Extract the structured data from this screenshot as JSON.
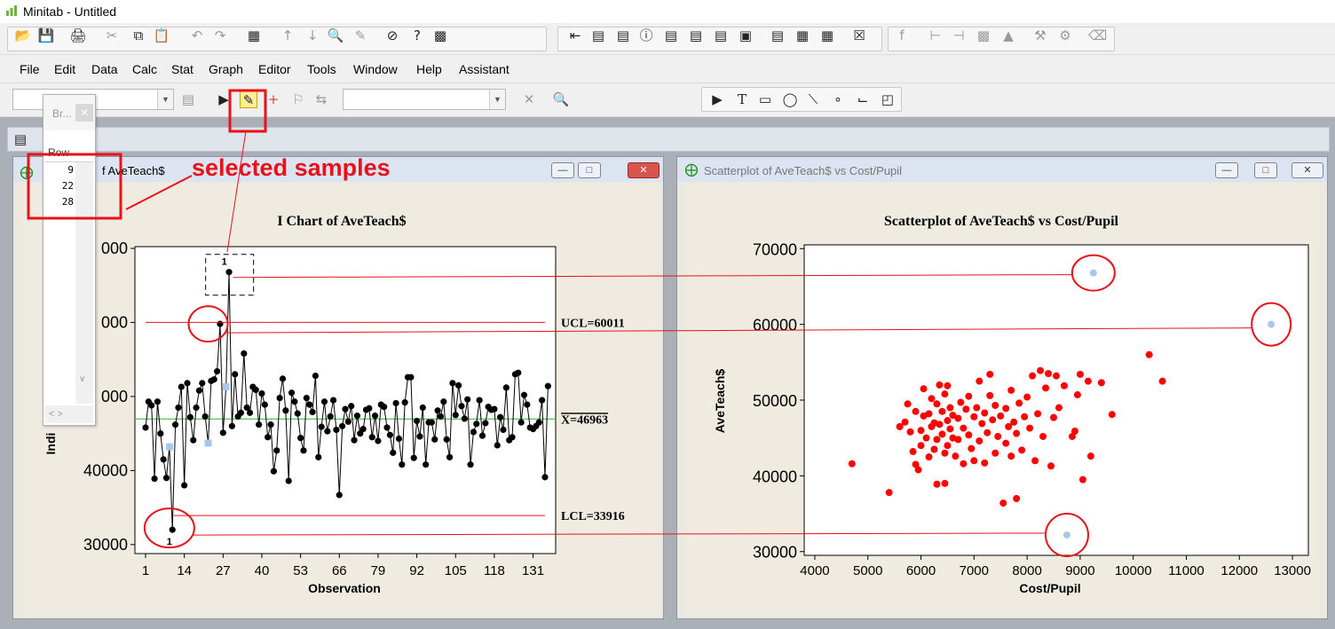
{
  "app": {
    "title": "Minitab - Untitled"
  },
  "menus": [
    "File",
    "Edit",
    "Data",
    "Calc",
    "Stat",
    "Graph",
    "Editor",
    "Tools",
    "Window",
    "Help",
    "Assistant"
  ],
  "menu_underline": [
    "F",
    "E",
    "D",
    "C",
    "S",
    "G",
    "E",
    "T",
    "W",
    "H",
    "A"
  ],
  "toolbar": {
    "icons": [
      "open-icon",
      "save-icon",
      "print-icon",
      "cut-icon",
      "copy-icon",
      "paste-icon",
      "undo-icon",
      "redo-icon",
      "worksheet-icon",
      "up-arrow-icon",
      "down-arrow-icon",
      "find-icon",
      "replace-icon",
      "cancel-icon",
      "help-icon",
      "assistant-icon"
    ]
  },
  "brush_palette": {
    "title": "Br...",
    "column_header": "Row",
    "rows": [
      "9",
      "22",
      "28"
    ]
  },
  "annotation": {
    "label": "selected samples",
    "color": "#e8121a"
  },
  "left_window": {
    "caption": "I Chart of AveTeach$",
    "caption_visible": "f AveTeach$"
  },
  "right_window": {
    "caption": "Scatterplot of AveTeach$ vs Cost/Pupil"
  },
  "chart_data": [
    {
      "type": "line",
      "title": "I Chart of AveTeach$",
      "xlabel": "Observation",
      "ylabel": "Indi",
      "xlim": [
        1,
        135
      ],
      "ylim": [
        29500,
        70000
      ],
      "x_ticks": [
        1,
        14,
        27,
        40,
        53,
        66,
        79,
        92,
        105,
        118,
        131
      ],
      "y_ticks_labels": [
        "000",
        "000",
        "000",
        "40000",
        "30000"
      ],
      "y_ticks_values": [
        70000,
        60000,
        50000,
        40000,
        30000
      ],
      "control_lines": [
        {
          "label": "UCL=60011",
          "value": 60011
        },
        {
          "label": "X=46963",
          "value": 46963
        },
        {
          "label": "LCL=33916",
          "value": 33916
        }
      ],
      "out_of_control_label": "1",
      "highlighted_points": [
        {
          "x": 9,
          "y": 32000
        },
        {
          "x": 22,
          "y": 59800
        },
        {
          "x": 28,
          "y": 66800
        }
      ],
      "values": [
        45800,
        49300,
        48800,
        38900,
        49300,
        45000,
        41500,
        39000,
        43200,
        32000,
        46200,
        48500,
        51300,
        38000,
        51800,
        47200,
        44100,
        48500,
        50800,
        51800,
        47300,
        43700,
        52100,
        52300,
        53400,
        59800,
        45100,
        51300,
        66800,
        46000,
        53000,
        47300,
        47800,
        55800,
        48500,
        47800,
        51300,
        50900,
        46200,
        50400,
        48900,
        44500,
        46200,
        39900,
        42700,
        49800,
        52400,
        48100,
        38600,
        50500,
        49300,
        47700,
        44400,
        42700,
        49800,
        48900,
        47900,
        52800,
        41800,
        45900,
        49300,
        45300,
        47300,
        49500,
        45500,
        36700,
        46000,
        48300,
        46600,
        48700,
        44100,
        47400,
        45000,
        45600,
        48200,
        48400,
        44500,
        47400,
        44000,
        48900,
        48600,
        45800,
        44800,
        42400,
        49100,
        44300,
        40800,
        49200,
        52600,
        52600,
        41700,
        46700,
        44600,
        48500,
        40800,
        46500,
        46500,
        44200,
        48100,
        47300,
        49300,
        44200,
        41800,
        51800,
        47500,
        51500,
        48700,
        47000,
        49600,
        40800,
        45200,
        46300,
        49500,
        44700,
        46400,
        48600,
        48200,
        48300,
        43400,
        47200,
        45500,
        51200,
        44100,
        44500,
        53000,
        53200,
        46500,
        50200,
        48900,
        45800,
        45600,
        46000,
        46500,
        49500,
        39100,
        51400
      ]
    },
    {
      "type": "scatter",
      "title": "Scatterplot of AveTeach$ vs Cost/Pupil",
      "xlabel": "Cost/Pupil",
      "ylabel": "AveTeach$",
      "xlim": [
        3800,
        13300
      ],
      "ylim": [
        29500,
        70500
      ],
      "x_ticks": [
        4000,
        5000,
        6000,
        7000,
        8000,
        9000,
        10000,
        11000,
        12000,
        13000
      ],
      "y_ticks": [
        30000,
        40000,
        50000,
        60000,
        70000
      ],
      "highlighted_points": [
        {
          "x": 9250,
          "y": 66800
        },
        {
          "x": 12600,
          "y": 60000
        },
        {
          "x": 8750,
          "y": 32200
        }
      ],
      "points": [
        [
          4700,
          41600
        ],
        [
          5400,
          37800
        ],
        [
          5600,
          46500
        ],
        [
          5700,
          47100
        ],
        [
          5750,
          49500
        ],
        [
          5800,
          45800
        ],
        [
          5850,
          43200
        ],
        [
          5900,
          48500
        ],
        [
          5900,
          41500
        ],
        [
          5950,
          40800
        ],
        [
          6000,
          46000
        ],
        [
          6000,
          44000
        ],
        [
          6050,
          47900
        ],
        [
          6050,
          51500
        ],
        [
          6100,
          45000
        ],
        [
          6150,
          42500
        ],
        [
          6150,
          48200
        ],
        [
          6200,
          46500
        ],
        [
          6200,
          50200
        ],
        [
          6250,
          43500
        ],
        [
          6250,
          47000
        ],
        [
          6300,
          49500
        ],
        [
          6300,
          44800
        ],
        [
          6300,
          38900
        ],
        [
          6350,
          46800
        ],
        [
          6350,
          52000
        ],
        [
          6400,
          45500
        ],
        [
          6400,
          48500
        ],
        [
          6450,
          43000
        ],
        [
          6450,
          50800
        ],
        [
          6450,
          39000
        ],
        [
          6500,
          47300
        ],
        [
          6500,
          44000
        ],
        [
          6500,
          51900
        ],
        [
          6550,
          46200
        ],
        [
          6550,
          49000
        ],
        [
          6600,
          45000
        ],
        [
          6600,
          48000
        ],
        [
          6650,
          42600
        ],
        [
          6700,
          47600
        ],
        [
          6700,
          44800
        ],
        [
          6750,
          49700
        ],
        [
          6800,
          46300
        ],
        [
          6800,
          41600
        ],
        [
          6850,
          48800
        ],
        [
          6900,
          45400
        ],
        [
          6900,
          50500
        ],
        [
          6950,
          43600
        ],
        [
          7000,
          47800
        ],
        [
          7000,
          42000
        ],
        [
          7050,
          49000
        ],
        [
          7100,
          44600
        ],
        [
          7100,
          52500
        ],
        [
          7150,
          46900
        ],
        [
          7200,
          48300
        ],
        [
          7200,
          41700
        ],
        [
          7250,
          45700
        ],
        [
          7300,
          50600
        ],
        [
          7300,
          53400
        ],
        [
          7350,
          47400
        ],
        [
          7400,
          43000
        ],
        [
          7400,
          49300
        ],
        [
          7450,
          45200
        ],
        [
          7500,
          47900
        ],
        [
          7550,
          36400
        ],
        [
          7600,
          44300
        ],
        [
          7600,
          48900
        ],
        [
          7650,
          46500
        ],
        [
          7700,
          42600
        ],
        [
          7700,
          51300
        ],
        [
          7750,
          47100
        ],
        [
          7800,
          37000
        ],
        [
          7800,
          45600
        ],
        [
          7850,
          49600
        ],
        [
          7900,
          43400
        ],
        [
          7950,
          47800
        ],
        [
          8000,
          50400
        ],
        [
          8050,
          46300
        ],
        [
          8100,
          53200
        ],
        [
          8150,
          42000
        ],
        [
          8200,
          48200
        ],
        [
          8250,
          53900
        ],
        [
          8300,
          45200
        ],
        [
          8350,
          51600
        ],
        [
          8400,
          53500
        ],
        [
          8450,
          41300
        ],
        [
          8500,
          47700
        ],
        [
          8550,
          53200
        ],
        [
          8600,
          49000
        ],
        [
          8700,
          51900
        ],
        [
          8850,
          45200
        ],
        [
          8900,
          45900
        ],
        [
          8950,
          50700
        ],
        [
          9000,
          53400
        ],
        [
          9050,
          39500
        ],
        [
          9150,
          52500
        ],
        [
          9200,
          42600
        ],
        [
          9400,
          52300
        ],
        [
          9600,
          48100
        ],
        [
          10300,
          56000
        ],
        [
          10550,
          52500
        ]
      ]
    }
  ],
  "colors": {
    "brush_highlight": "#a7c8ec",
    "ucl_line": "#e8121a",
    "center_line": "#2bb52b",
    "scatter_point": "#ff0000"
  }
}
